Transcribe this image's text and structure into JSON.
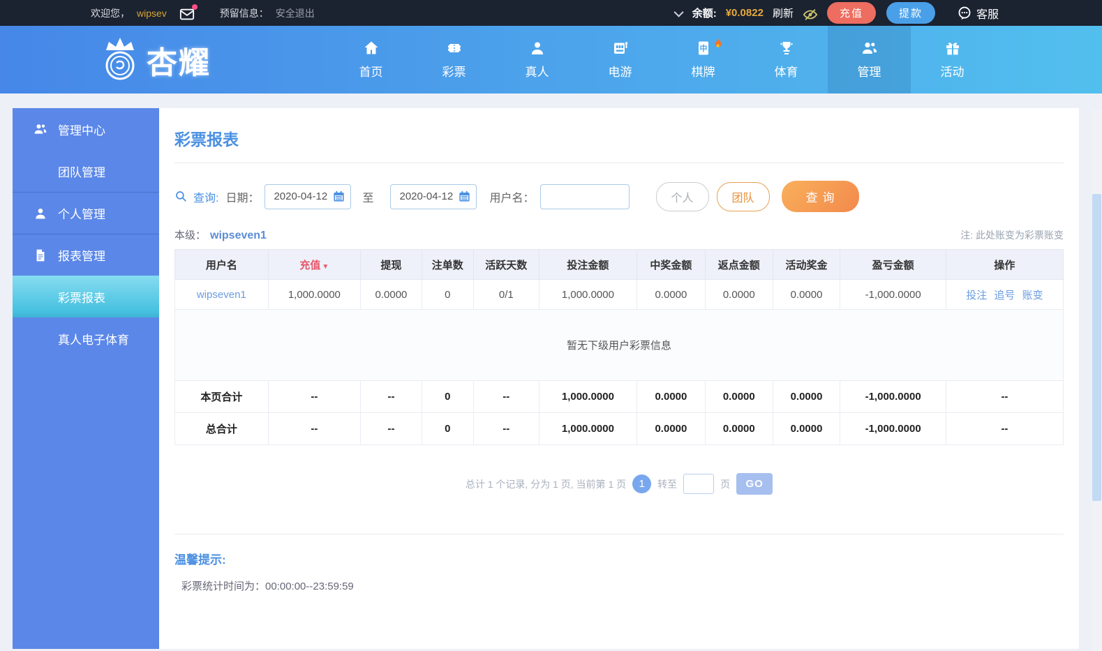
{
  "colors": {
    "topbar_bg": "#1b2230",
    "accent_yellow": "#e8a93c",
    "deposit_red": "#ed6d60",
    "withdraw_blue": "#4aa0e8",
    "nav_gradient_left": "#4687e8",
    "nav_gradient_right": "#52bfee",
    "sidebar_blue": "#5b87e8",
    "sidebar_active_cyan": "#47c1e0",
    "title_blue": "#4a90e2",
    "query_orange": "#f2894c",
    "negative_red": "#e23b3b"
  },
  "topbar": {
    "welcome": "欢迎您，",
    "username": "wipsev",
    "reserved_label": "预留信息：",
    "logout": "安全退出",
    "balance_label": "余额:",
    "balance_value": "¥0.0822",
    "refresh": "刷新",
    "deposit": "充值",
    "withdraw": "提款",
    "service": "客服"
  },
  "nav": {
    "logo": "杏耀",
    "items": [
      {
        "label": "首页"
      },
      {
        "label": "彩票"
      },
      {
        "label": "真人"
      },
      {
        "label": "电游"
      },
      {
        "label": "棋牌"
      },
      {
        "label": "体育"
      },
      {
        "label": "管理"
      },
      {
        "label": "活动"
      }
    ]
  },
  "sidebar": {
    "items": [
      {
        "label": "管理中心"
      },
      {
        "label": "团队管理"
      },
      {
        "label": "个人管理"
      },
      {
        "label": "报表管理"
      },
      {
        "label": "彩票报表"
      },
      {
        "label": "真人电子体育"
      }
    ]
  },
  "main": {
    "title": "彩票报表",
    "search": {
      "query_label": "查询:",
      "date_label": "日期：",
      "date_from": "2020-04-12",
      "to_label": "至",
      "date_to": "2020-04-12",
      "username_label": "用户名：",
      "personal_btn": "个人",
      "team_btn": "团队",
      "submit_btn": "查询"
    },
    "level_label": "本级：",
    "level_user": "wipseven1",
    "note": "注: 此处账变为彩票账变",
    "table": {
      "headers": [
        "用户名",
        "充值",
        "提现",
        "注单数",
        "活跃天数",
        "投注金额",
        "中奖金额",
        "返点金额",
        "活动奖金",
        "盈亏金额",
        "操作"
      ],
      "sort_indicator": "▼",
      "user_row": {
        "username": "wipseven1",
        "cells": [
          "1,000.0000",
          "0.0000",
          "0",
          "0/1",
          "1,000.0000",
          "0.0000",
          "0.0000",
          "0.0000"
        ],
        "profit": "-1,000.0000",
        "actions": [
          "投注",
          "追号",
          "账变"
        ]
      },
      "empty_text": "暂无下级用户彩票信息",
      "page_total": {
        "label": "本页合计",
        "cells": [
          "--",
          "--",
          "0",
          "--",
          "1,000.0000",
          "0.0000",
          "0.0000",
          "0.0000"
        ],
        "profit": "-1,000.0000",
        "op": "--"
      },
      "grand_total": {
        "label": "总合计",
        "cells": [
          "--",
          "--",
          "0",
          "--",
          "1,000.0000",
          "0.0000",
          "0.0000",
          "0.0000"
        ],
        "profit": "-1,000.0000",
        "op": "--"
      }
    },
    "pagination": {
      "summary": "总计 1 个记录, 分为 1 页, 当前第 1 页",
      "current_page": "1",
      "goto_label": "转至",
      "page_unit": "页",
      "go_btn": "GO"
    },
    "tips": {
      "title": "温馨提示:",
      "line": "彩票统计时间为：00:00:00--23:59:59"
    }
  }
}
